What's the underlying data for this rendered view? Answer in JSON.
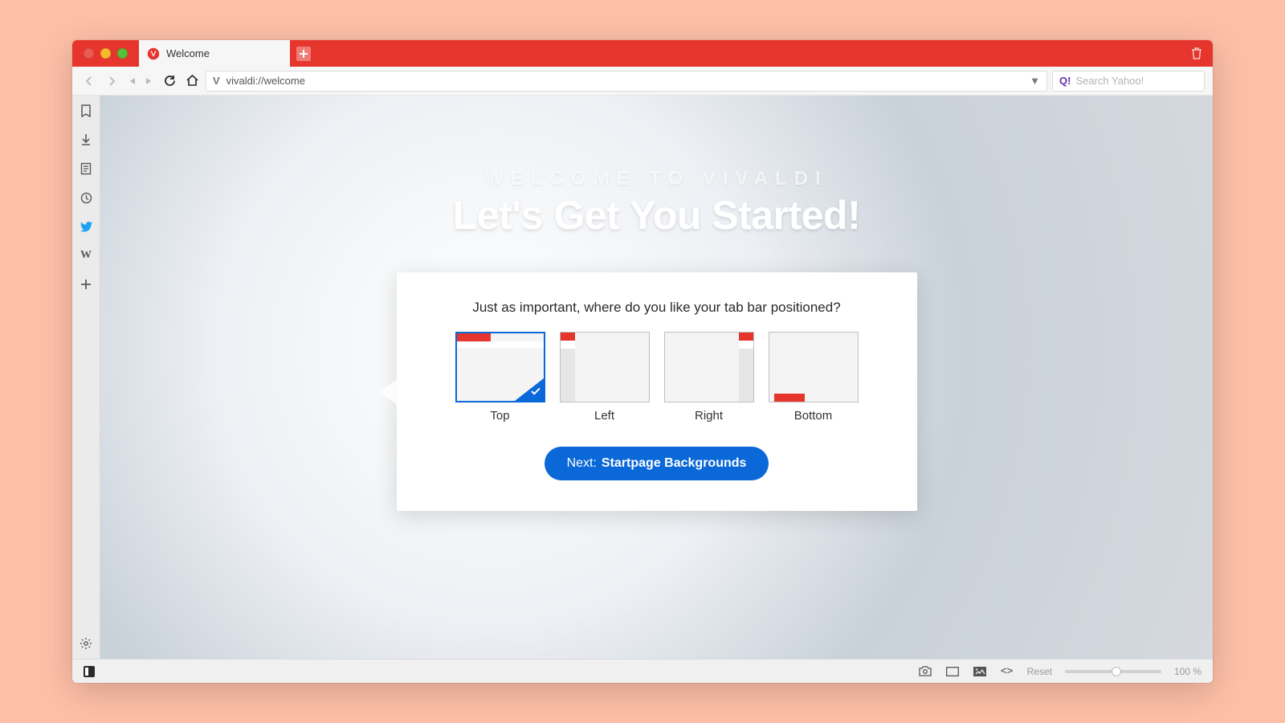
{
  "tab": {
    "title": "Welcome"
  },
  "toolbar": {
    "address": "vivaldi://welcome",
    "search_placeholder": "Search Yahoo!"
  },
  "sidebar": {
    "wiki_letter": "W"
  },
  "welcome": {
    "subtitle": "WELCOME TO VIVALDI",
    "title": "Let's Get You Started!"
  },
  "card": {
    "question": "Just as important, where do you like your tab bar positioned?",
    "options": [
      {
        "label": "Top"
      },
      {
        "label": "Left"
      },
      {
        "label": "Right"
      },
      {
        "label": "Bottom"
      }
    ],
    "next_prefix": "Next:",
    "next_bold": "Startpage Backgrounds"
  },
  "statusbar": {
    "reset": "Reset",
    "zoom": "100 %"
  }
}
